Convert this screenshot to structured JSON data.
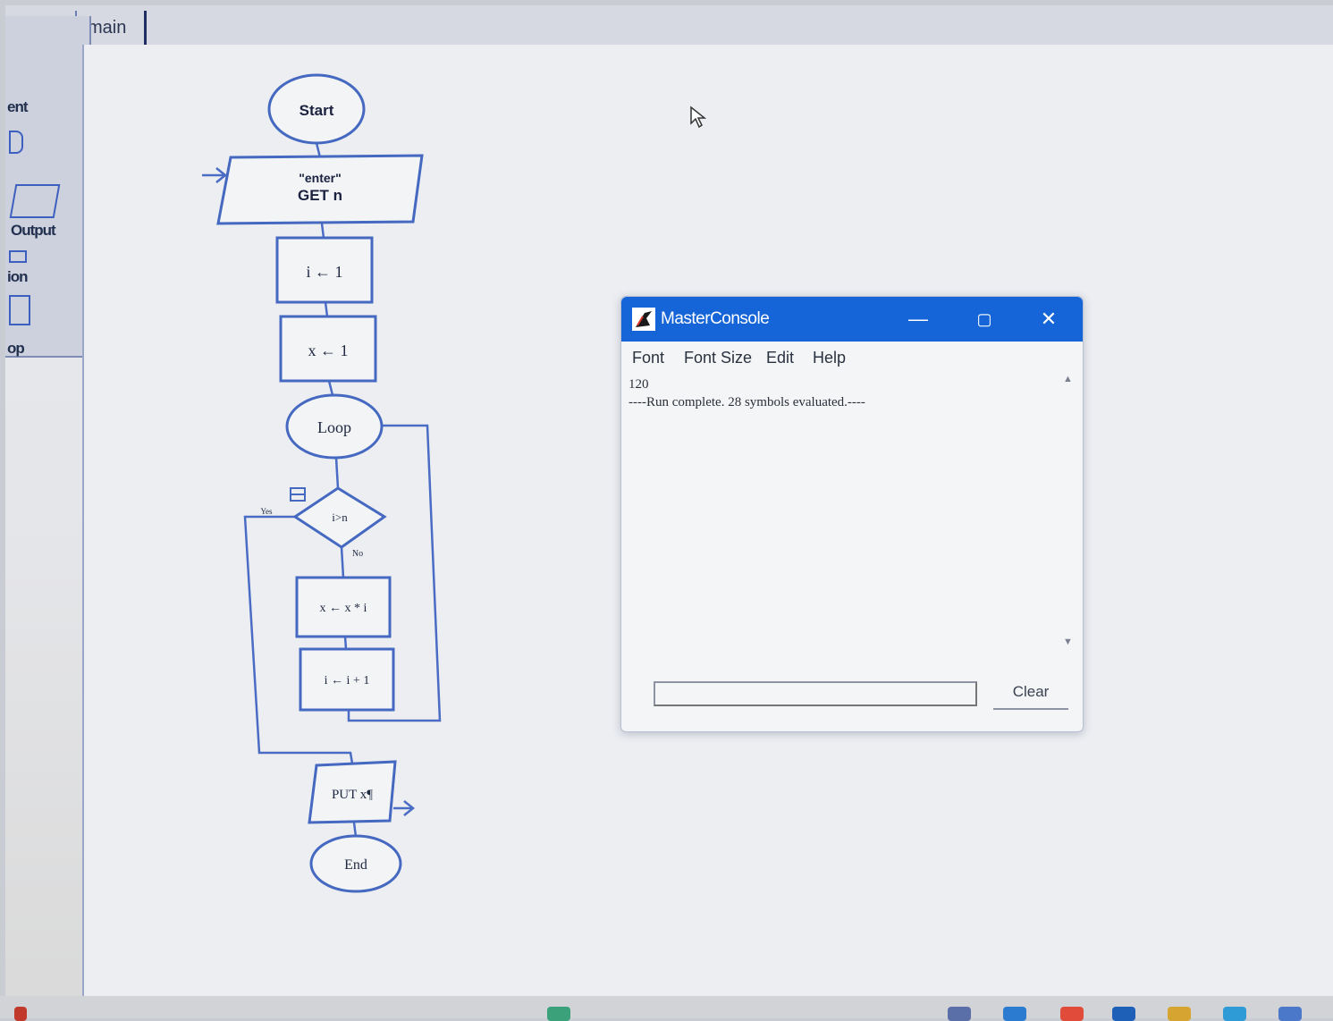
{
  "editor": {
    "tab_label": "main",
    "palette": {
      "items": [
        {
          "label": "ent"
        },
        {
          "label": "Output"
        },
        {
          "label": "ion"
        },
        {
          "label": "op"
        }
      ]
    }
  },
  "flowchart": {
    "start_label": "Start",
    "input_prompt": "\"enter\"",
    "input_var": "GET n",
    "assign_i": "i ← 1",
    "assign_x": "x ← 1",
    "loop_label": "Loop",
    "decision_label": "i>n",
    "yes_label": "Yes",
    "no_label": "No",
    "assign_x_mul": "x ← x * i",
    "assign_i_inc": "i ← i + 1",
    "output_label": "PUT x¶",
    "end_label": "End"
  },
  "console": {
    "title": "MasterConsole",
    "menu": [
      {
        "label": "Font"
      },
      {
        "label": "Font Size"
      },
      {
        "label": "Edit"
      },
      {
        "label": "Help"
      }
    ],
    "output_lines": [
      "120",
      "----Run complete.  28 symbols evaluated.----"
    ],
    "input_value": "",
    "clear_label": "Clear"
  },
  "colors": {
    "title_bar": "#1565d8",
    "flow_stroke": "#4568c0"
  }
}
